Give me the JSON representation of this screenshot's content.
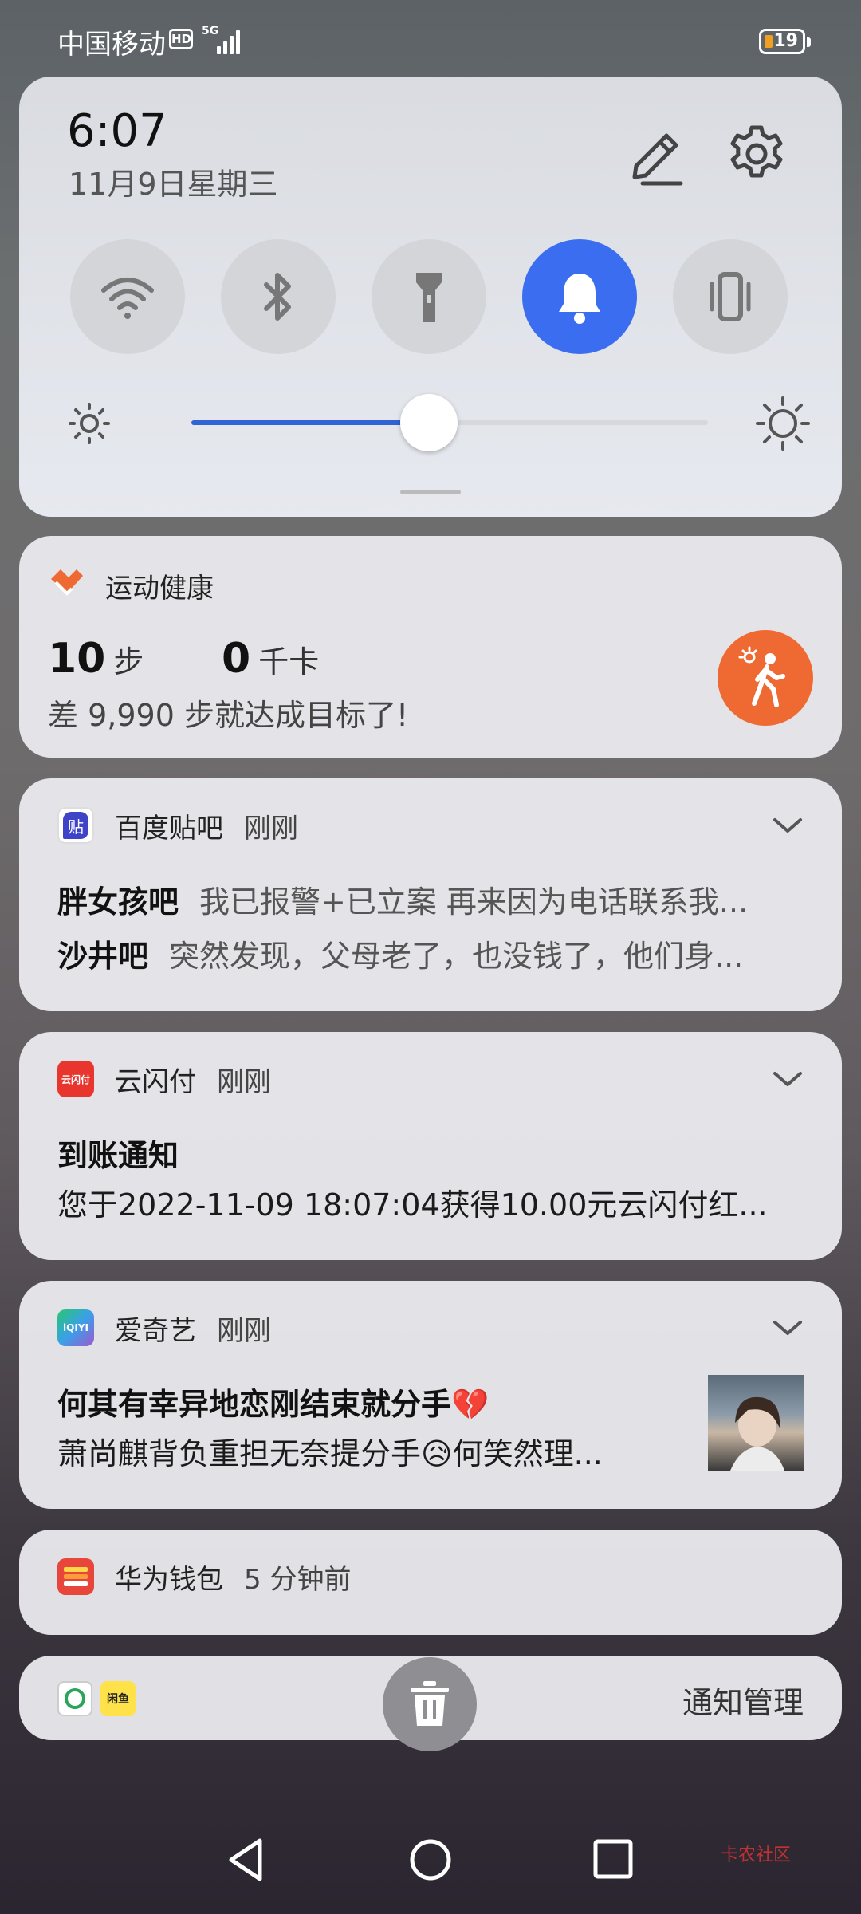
{
  "status_bar": {
    "carrier": "中国移动",
    "hd": "HD",
    "network": "5G",
    "battery": "19"
  },
  "quick_settings": {
    "time": "6:07",
    "date": "11月9日星期三",
    "toggles": [
      {
        "name": "wifi",
        "on": false
      },
      {
        "name": "bluetooth",
        "on": false
      },
      {
        "name": "flashlight",
        "on": false
      },
      {
        "name": "sound",
        "on": true
      },
      {
        "name": "vibrate",
        "on": false
      }
    ],
    "brightness_level": 0.46,
    "accent_color": "#3a6df0"
  },
  "health": {
    "app_name": "运动健康",
    "steps_value": "10",
    "steps_unit": "步",
    "kcal_value": "0",
    "kcal_unit": "千卡",
    "goal_text": "差 9,990 步就达成目标了!"
  },
  "notifications": [
    {
      "app_name": "百度贴吧",
      "time": "刚刚",
      "lines": [
        {
          "bold": "胖女孩吧",
          "text": "我已报警+已立案 再来因为电话联系我..."
        },
        {
          "bold": "沙井吧",
          "text": "突然发现，父母老了，也没钱了，他们身..."
        }
      ]
    },
    {
      "app_name": "云闪付",
      "time": "刚刚",
      "title": "到账通知",
      "body": "您于2022-11-09 18:07:04获得10.00元云闪付红..."
    },
    {
      "app_name": "爱奇艺",
      "time": "刚刚",
      "title": "何其有幸异地恋刚结束就分手💔",
      "body": "萧尚麒背负重担无奈提分手😥何笑然理..."
    },
    {
      "app_name": "华为钱包",
      "time": "5 分钟前"
    }
  ],
  "manage_bar": {
    "label": "通知管理"
  },
  "app_icons": {
    "tieba_glyph": "贴",
    "ysf_glyph": "云闪付",
    "iqiyi_glyph": "iQIYI",
    "bottom_icon2_glyph": "闲鱼"
  },
  "watermark": "卡农社区"
}
